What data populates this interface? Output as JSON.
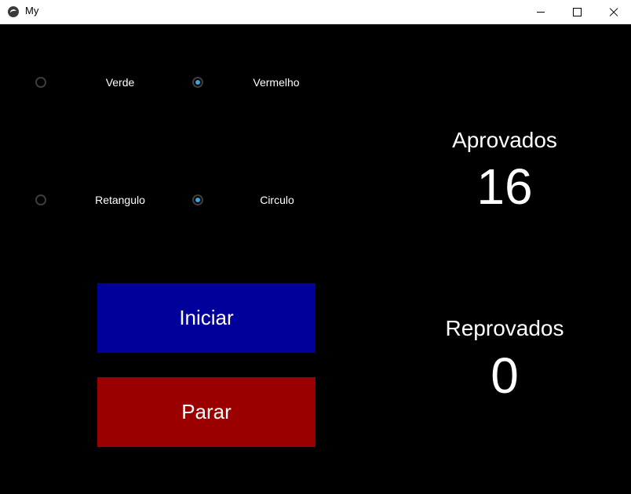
{
  "window": {
    "title": "My"
  },
  "options": {
    "color": [
      {
        "label": "Verde",
        "checked": false
      },
      {
        "label": "Vermelho",
        "checked": true
      }
    ],
    "shape": [
      {
        "label": "Retangulo",
        "checked": false
      },
      {
        "label": "Circulo",
        "checked": true
      }
    ]
  },
  "buttons": {
    "start": "Iniciar",
    "stop": "Parar"
  },
  "stats": {
    "approved_label": "Aprovados",
    "approved_value": "16",
    "rejected_label": "Reprovados",
    "rejected_value": "0"
  },
  "colors": {
    "accent": "#35a7e0",
    "start_button": "#00009b",
    "stop_button": "#9b0000",
    "background": "#000000"
  }
}
